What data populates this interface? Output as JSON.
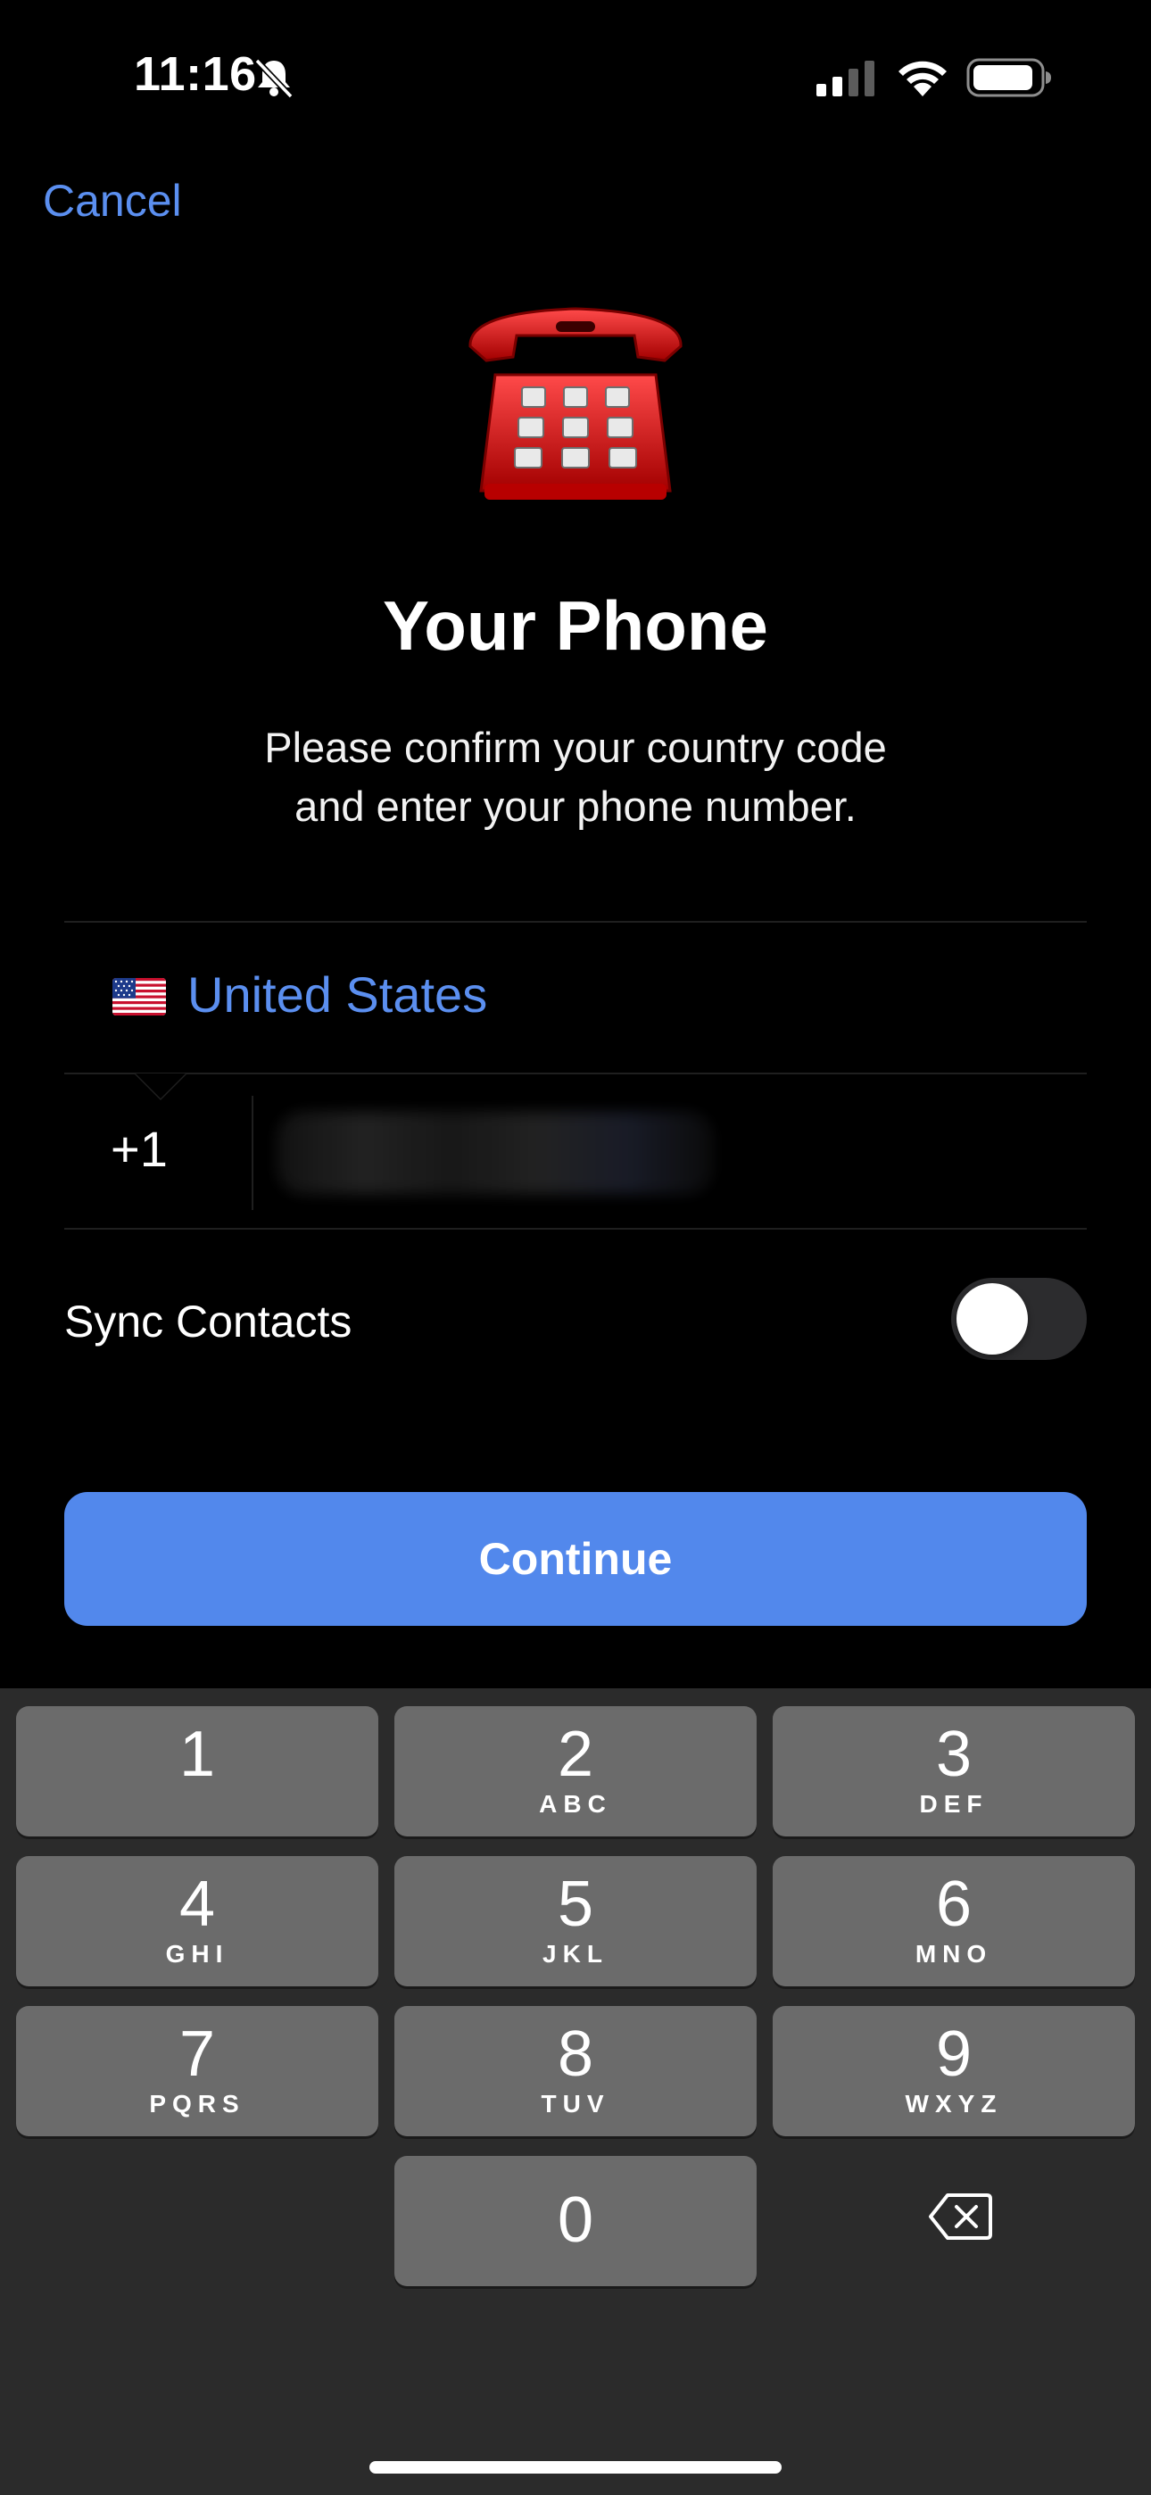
{
  "status_bar": {
    "time": "11:16"
  },
  "nav": {
    "cancel_label": "Cancel"
  },
  "header": {
    "title": "Your Phone",
    "subtitle_line1": "Please confirm your country code",
    "subtitle_line2": "and enter your phone number."
  },
  "country": {
    "name": "United States",
    "flag_icon": "us-flag-icon",
    "code": "+1"
  },
  "phone": {
    "value": "",
    "note": "blurred"
  },
  "sync": {
    "label": "Sync Contacts",
    "enabled": false
  },
  "actions": {
    "continue_label": "Continue",
    "accent_color": "#5288ec"
  },
  "keypad": {
    "keys": [
      {
        "digit": "1",
        "letters": ""
      },
      {
        "digit": "2",
        "letters": "ABC"
      },
      {
        "digit": "3",
        "letters": "DEF"
      },
      {
        "digit": "4",
        "letters": "GHI"
      },
      {
        "digit": "5",
        "letters": "JKL"
      },
      {
        "digit": "6",
        "letters": "MNO"
      },
      {
        "digit": "7",
        "letters": "PQRS"
      },
      {
        "digit": "8",
        "letters": "TUV"
      },
      {
        "digit": "9",
        "letters": "WXYZ"
      },
      {
        "digit": "0",
        "letters": ""
      }
    ]
  }
}
